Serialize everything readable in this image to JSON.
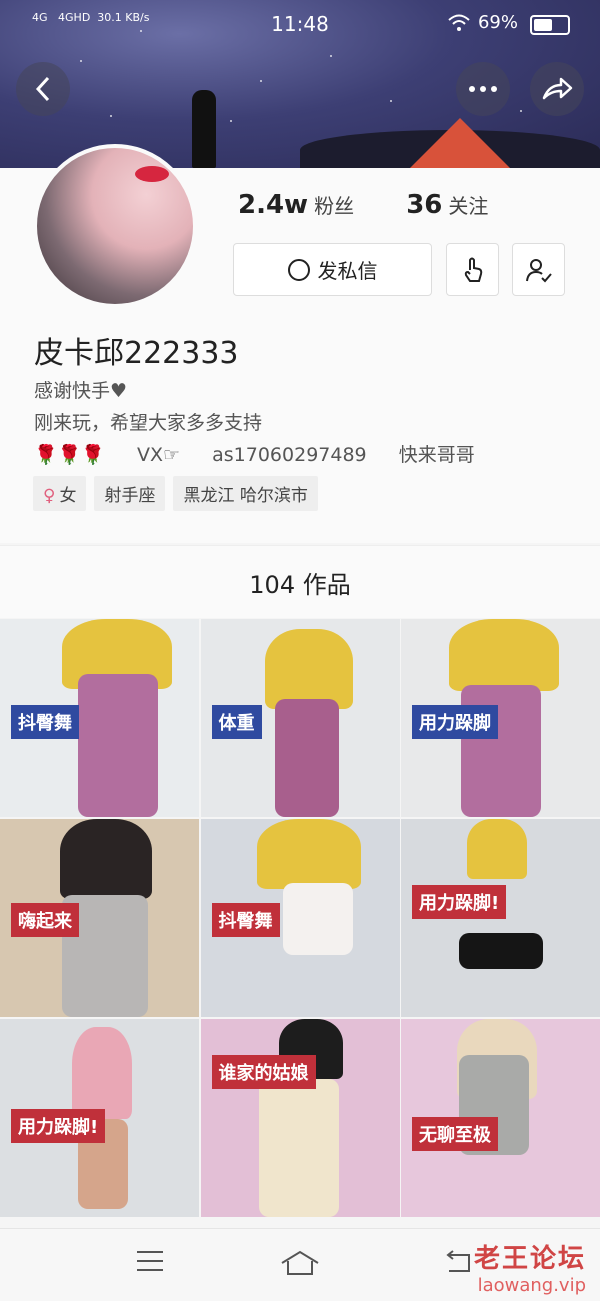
{
  "status_bar": {
    "signal_left": "4G",
    "signal_right": "4GHD",
    "net_speed": "30.1",
    "net_unit": "KB/s",
    "time": "11:48",
    "battery_percent": "69%"
  },
  "header": {
    "back_icon": "back-arrow-icon",
    "more_icon": "more-dots-icon",
    "share_icon": "share-arrow-icon"
  },
  "profile": {
    "followers_count": "2.4w",
    "followers_label": "粉丝",
    "following_count": "36",
    "following_label": "关注",
    "message_button": "发私信",
    "name": "皮卡邱222333",
    "bio_line1": "感谢快手♥",
    "bio_line2": "刚来玩，希望大家多多支持",
    "bio_line3_roses": "🌹🌹🌹",
    "bio_line3_vx": "VX☞",
    "bio_line3_id": "as17060297489",
    "bio_line3_end": "快来哥哥",
    "tags": [
      "女",
      "射手座",
      "黑龙江 哈尔滨市"
    ]
  },
  "works": {
    "title": "104 作品",
    "items": [
      {
        "label": "抖臀舞",
        "label_color": "#2f4aa0"
      },
      {
        "label": "体重",
        "label_color": "#2f4aa0"
      },
      {
        "label": "用力跺脚",
        "label_color": "#2f4aa0"
      },
      {
        "label": "嗨起来",
        "label_color": "#c0303a"
      },
      {
        "label": "抖臀舞",
        "label_color": "#c0303a"
      },
      {
        "label": "用力跺脚!",
        "label_color": "#c0303a"
      },
      {
        "label": "用力跺脚!",
        "label_color": "#c0303a"
      },
      {
        "label": "谁家的姑娘",
        "label_color": "#c0303a"
      },
      {
        "label": "无聊至极",
        "label_color": "#c0303a"
      }
    ]
  },
  "nav": {
    "menu_icon": "menu-icon",
    "home_icon": "home-icon",
    "back_icon": "back-icon"
  },
  "watermark": {
    "title": "老王论坛",
    "url": "laowang.vip"
  }
}
